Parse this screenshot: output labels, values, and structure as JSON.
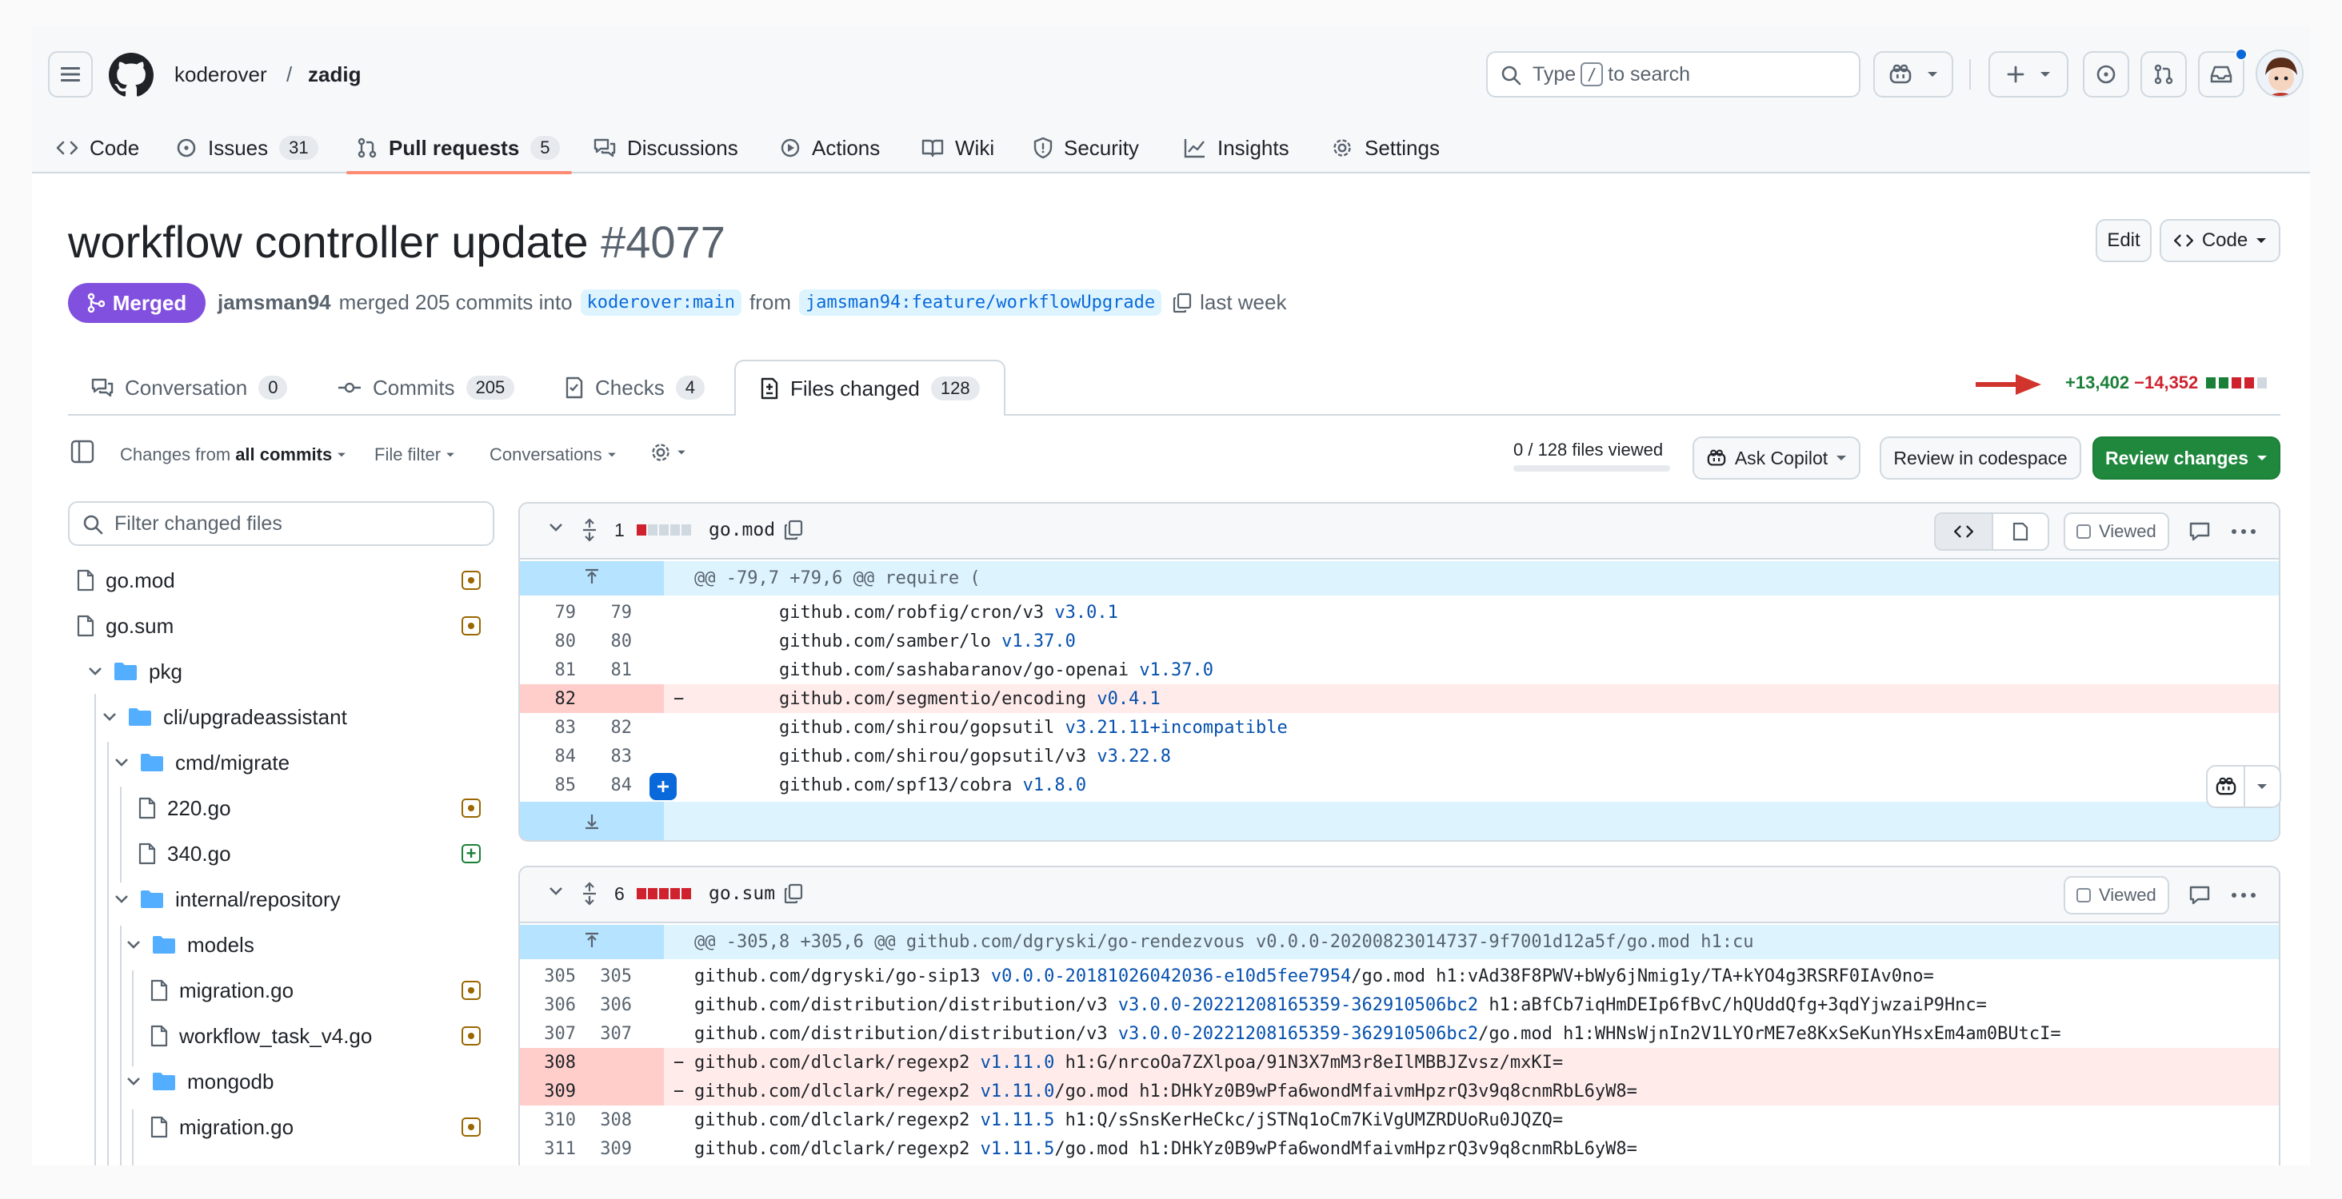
{
  "header": {
    "owner": "koderover",
    "separator": "/",
    "repo": "zadig",
    "search_label": "Type",
    "search_key": "/",
    "search_suffix": "to search"
  },
  "repo_tabs": [
    {
      "label": "Code",
      "icon": "code-icon"
    },
    {
      "label": "Issues",
      "count": "31",
      "icon": "issue-icon"
    },
    {
      "label": "Pull requests",
      "count": "5",
      "icon": "pull-request-icon"
    },
    {
      "label": "Discussions",
      "icon": "discussion-icon"
    },
    {
      "label": "Actions",
      "icon": "play-icon"
    },
    {
      "label": "Wiki",
      "icon": "book-icon"
    },
    {
      "label": "Security",
      "icon": "shield-icon"
    },
    {
      "label": "Insights",
      "icon": "graph-icon"
    },
    {
      "label": "Settings",
      "icon": "gear-icon"
    }
  ],
  "pr": {
    "title": "workflow controller update",
    "number": "#4077",
    "state": "Merged",
    "author": "jamsman94",
    "action_text": "merged 205 commits into",
    "base_branch": "koderover:main",
    "from_text": "from",
    "head_branch": "jamsman94:feature/workflowUpgrade",
    "time": "last week",
    "edit_label": "Edit",
    "code_label": "Code"
  },
  "pr_tabs": [
    {
      "label": "Conversation",
      "count": "0"
    },
    {
      "label": "Commits",
      "count": "205"
    },
    {
      "label": "Checks",
      "count": "4"
    },
    {
      "label": "Files changed",
      "count": "128"
    }
  ],
  "diffstat": {
    "additions": "+13,402",
    "deletions": "−14,352"
  },
  "toolbar": {
    "changes_from": "Changes from",
    "all_commits": "all commits",
    "file_filter": "File filter",
    "conversations": "Conversations",
    "files_viewed": "0 / 128 files viewed",
    "ask_copilot": "Ask Copilot",
    "review_codespace": "Review in codespace",
    "review_changes": "Review changes"
  },
  "sidebar": {
    "filter_placeholder": "Filter changed files",
    "items": [
      {
        "label": "go.mod",
        "type": "file",
        "status": "modified"
      },
      {
        "label": "go.sum",
        "type": "file",
        "status": "modified"
      },
      {
        "label": "pkg",
        "type": "folder"
      },
      {
        "label": "cli/upgradeassistant",
        "type": "folder"
      },
      {
        "label": "cmd/migrate",
        "type": "folder"
      },
      {
        "label": "220.go",
        "type": "file",
        "status": "modified"
      },
      {
        "label": "340.go",
        "type": "file",
        "status": "added"
      },
      {
        "label": "internal/repository",
        "type": "folder"
      },
      {
        "label": "models",
        "type": "folder"
      },
      {
        "label": "migration.go",
        "type": "file",
        "status": "modified"
      },
      {
        "label": "workflow_task_v4.go",
        "type": "file",
        "status": "modified"
      },
      {
        "label": "mongodb",
        "type": "folder"
      },
      {
        "label": "migration.go",
        "type": "file",
        "status": "modified"
      }
    ]
  },
  "files": [
    {
      "name": "go.mod",
      "changes": "1",
      "viewed_label": "Viewed",
      "hunk": "@@ -79,7 +79,6 @@ require (",
      "lines": [
        {
          "old": "79",
          "new": "79",
          "mark": "",
          "pkg": "github.com/robfig/cron/v3",
          "ver": "v3.0.1"
        },
        {
          "old": "80",
          "new": "80",
          "mark": "",
          "pkg": "github.com/samber/lo",
          "ver": "v1.37.0"
        },
        {
          "old": "81",
          "new": "81",
          "mark": "",
          "pkg": "github.com/sashabaranov/go-openai",
          "ver": "v1.37.0"
        },
        {
          "old": "82",
          "new": "",
          "mark": "−",
          "pkg": "github.com/segmentio/encoding",
          "ver": "v0.4.1"
        },
        {
          "old": "83",
          "new": "82",
          "mark": "",
          "pkg": "github.com/shirou/gopsutil",
          "ver": "v3.21.11+incompatible"
        },
        {
          "old": "84",
          "new": "83",
          "mark": "",
          "pkg": "github.com/shirou/gopsutil/v3",
          "ver": "v3.22.8"
        },
        {
          "old": "85",
          "new": "84",
          "mark": "",
          "pkg": "github.com/spf13/cobra",
          "ver": "v1.8.0"
        }
      ]
    },
    {
      "name": "go.sum",
      "changes": "6",
      "viewed_label": "Viewed",
      "hunk": "@@ -305,8 +305,6 @@ github.com/dgryski/go-rendezvous v0.0.0-20200823014737-9f7001d12a5f/go.mod h1:cu",
      "lines": [
        {
          "old": "305",
          "new": "305",
          "mark": "",
          "pkg": "github.com/dgryski/go-sip13",
          "ver": "v0.0.0-20181026042036-e10d5fee7954",
          "rest": "/go.mod h1:vAd38F8PWV+bWy6jNmig1y/TA+kYO4g3RSRF0IAv0no="
        },
        {
          "old": "306",
          "new": "306",
          "mark": "",
          "pkg": "github.com/distribution/distribution/v3",
          "ver": "v3.0.0-20221208165359-362910506bc2",
          "rest": " h1:aBfCb7iqHmDEIp6fBvC/hQUddQfg+3qdYjwzaiP9Hnc="
        },
        {
          "old": "307",
          "new": "307",
          "mark": "",
          "pkg": "github.com/distribution/distribution/v3",
          "ver": "v3.0.0-20221208165359-362910506bc2",
          "rest": "/go.mod h1:WHNsWjnIn2V1LYOrME7e8KxSeKunYHsxEm4am0BUtcI="
        },
        {
          "old": "308",
          "new": "",
          "mark": "−",
          "pkg": "github.com/dlclark/regexp2",
          "ver": "v1.11.0",
          "rest": " h1:G/nrcoOa7ZXlpoa/91N3X7mM3r8eIlMBBJZvsz/mxKI="
        },
        {
          "old": "309",
          "new": "",
          "mark": "−",
          "pkg": "github.com/dlclark/regexp2",
          "ver": "v1.11.0",
          "rest": "/go.mod h1:DHkYz0B9wPfa6wondMfaivmHpzrQ3v9q8cnmRbL6yW8="
        },
        {
          "old": "310",
          "new": "308",
          "mark": "",
          "pkg": "github.com/dlclark/regexp2",
          "ver": "v1.11.5",
          "rest": " h1:Q/sSnsKerHeCkc/jSTNq1oCm7KiVgUMZRDUoRu0JQZQ="
        },
        {
          "old": "311",
          "new": "309",
          "mark": "",
          "pkg": "github.com/dlclark/regexp2",
          "ver": "v1.11.5",
          "rest": "/go.mod h1:DHkYz0B9wPfa6wondMfaivmHpzrQ3v9q8cnmRbL6yW8="
        }
      ]
    }
  ],
  "colors": {
    "accent": "#0969da",
    "merged": "#8250df",
    "added": "#1a7f37",
    "deleted": "#cf222e",
    "annotation_arrow": "#d0342c"
  }
}
